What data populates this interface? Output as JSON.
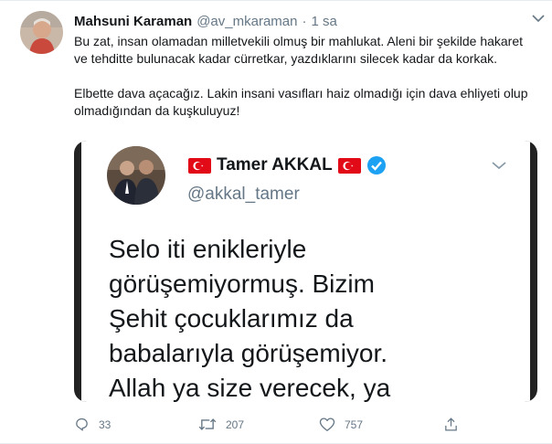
{
  "tweet": {
    "name": "Mahsuni Karaman",
    "handle": "@av_mkaraman",
    "separator": "·",
    "time": "1 sa",
    "paragraphs": [
      "Bu zat, insan olamadan milletvekili olmuş bir mahlukat. Aleni bir şekilde hakaret ve tehditte bulunacak kadar cürretkar, yazdıklarını silecek kadar da korkak.",
      "Elbette dava açacağız. Lakin insani vasıfları haiz olmadığı için dava ehliyeti olup olmadığından da kuşkuluyuz!"
    ]
  },
  "embedded": {
    "name": "Tamer AKKAL",
    "handle": "@akkal_tamer",
    "lines": [
      "Selo iti enikleriyle",
      "görüşemiyormuş. Bizim",
      "Şehit çocuklarımız da",
      "babalarıyla görüşemiyor.",
      "Allah ya size verecek, ya"
    ]
  },
  "actions": {
    "replies": "33",
    "retweets": "207",
    "likes": "757"
  },
  "icons": {
    "caret": "chevron-down-icon",
    "reply": "reply-icon",
    "retweet": "retweet-icon",
    "like": "heart-icon",
    "share": "share-icon",
    "verified": "verified-badge-icon",
    "flag": "turkey-flag-icon"
  },
  "colors": {
    "text": "#14171a",
    "muted": "#657786",
    "verified": "#1da1f2",
    "flag": "#e30a17"
  }
}
